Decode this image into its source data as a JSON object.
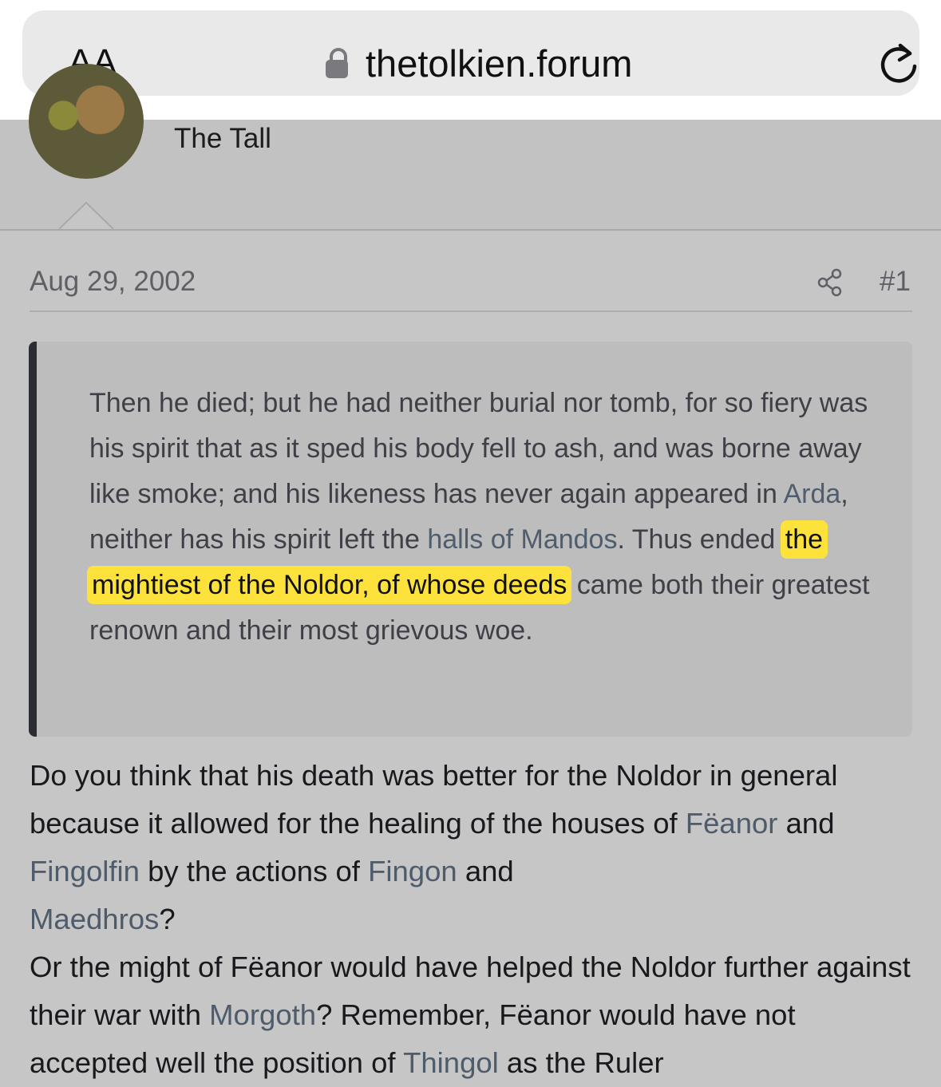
{
  "browser": {
    "reader_button": "AA",
    "url": "thetolkien.forum",
    "icons": {
      "lock": "lock-icon",
      "reload": "reload-icon"
    }
  },
  "profile": {
    "user_title": "The Tall"
  },
  "post": {
    "date": "Aug 29, 2002",
    "number": "#1",
    "share_icon": "share-icon",
    "quote": {
      "t1": "Then he died; but he had neither burial nor tomb, for so fiery was his spirit that as it sped his body fell to ash, and was borne away like smoke; and his likeness has never again appeared in ",
      "link_arda": "Arda",
      "t2": ", neither has his spirit left the ",
      "link_halls": "halls of Mandos",
      "t3": ". Thus ended ",
      "highlight": "the mightiest of the Noldor, of whose deeds",
      "t4": " came both their greatest renown and their most grievous woe."
    },
    "body": {
      "p1": "Do you think that his death was better for the Noldor in general because it allowed for the healing of the houses of ",
      "link_feanor": "Fëanor",
      "p2": " and ",
      "link_fingolfin": "Fingolfin",
      "p3": " by the actions of ",
      "link_fingon": "Fingon",
      "p4": " and ",
      "link_maedhros": "Maedhros",
      "p5": "?",
      "p6": "Or the might of Fëanor would have helped the Noldor further against their war with ",
      "link_morgoth": "Morgoth",
      "p7": "? Remember, Fëanor would have not accepted well the position of ",
      "link_thingol": "Thingol",
      "p8": " as the Ruler"
    }
  },
  "colors": {
    "highlight": "#fde23b",
    "link": "#4d5b6b",
    "background": "#c6c6c6"
  }
}
